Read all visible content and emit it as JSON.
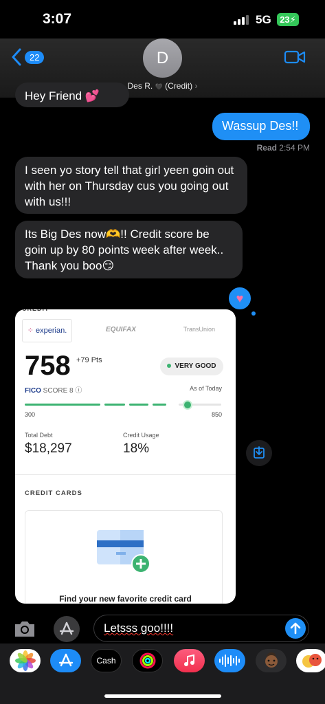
{
  "status": {
    "time": "3:07",
    "network": "5G",
    "battery": "23"
  },
  "header": {
    "back_count": "22",
    "avatar_initial": "D",
    "contact_name": "Des R.",
    "contact_suffix": "(Credit)",
    "chevron": "›"
  },
  "messages": [
    {
      "dir": "in",
      "text": "Hey Friend"
    },
    {
      "dir": "out",
      "text": "Wassup Des!!"
    },
    {
      "dir": "in",
      "text": "I seen yo story tell that girl yeen goin out with her on Thursday cus you going out with us!!!"
    },
    {
      "dir": "in",
      "text": "Its Big Des now🫶!! Credit score be goin up by 80 points week after week.. Thank you boo😏"
    }
  ],
  "read_receipt": {
    "label": "Read",
    "time": "2:54 PM"
  },
  "tapback": {
    "icon": "heart-icon",
    "glyph": "♥"
  },
  "credit_screenshot": {
    "bureaus": [
      "experian.",
      "EQUIFAX",
      "TransUnion"
    ],
    "score": "758",
    "points_change": "+79 Pts",
    "rating": "VERY GOOD",
    "fico_label": "FICO",
    "fico_score_label": "SCORE 8",
    "as_of": "As of Today",
    "range_min": "300",
    "range_max": "850",
    "score_progress": 0.83,
    "total_debt_label": "Total Debt",
    "total_debt_value": "$18,297",
    "credit_usage_label": "Credit Usage",
    "credit_usage_value": "18%",
    "credit_cards_heading": "CREDIT CARDS",
    "find_card_text": "Find your new favorite credit card"
  },
  "composer": {
    "text": "Letsss goo!!!!"
  },
  "app_drawer": [
    {
      "name": "photos",
      "icon": "photos-icon"
    },
    {
      "name": "app-store",
      "icon": "app-store-icon"
    },
    {
      "name": "cash",
      "label": "Cash",
      "icon": "apple-cash-icon"
    },
    {
      "name": "activity",
      "icon": "activity-rings-icon"
    },
    {
      "name": "music",
      "icon": "music-note-icon"
    },
    {
      "name": "audio",
      "icon": "waveform-icon"
    },
    {
      "name": "memoji",
      "icon": "memoji-icon"
    },
    {
      "name": "memoji-stickers",
      "icon": "memoji-stickers-icon"
    }
  ],
  "colors": {
    "imessage_blue": "#1f8ff5",
    "received_bubble": "#262628",
    "battery_green": "#34c759",
    "score_green": "#3cb371"
  }
}
